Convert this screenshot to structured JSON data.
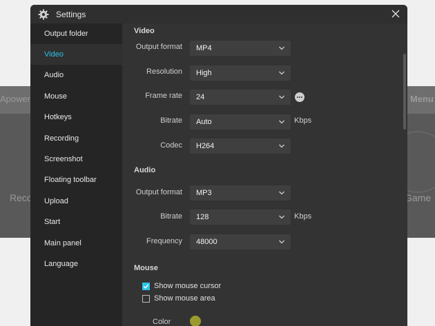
{
  "background": {
    "left_text": "ApowerR",
    "right_text": "Menu",
    "left_bottom": "Reco",
    "right_bottom": "Game"
  },
  "dialog": {
    "title": "Settings",
    "icons": {
      "settings": "gear-icon",
      "close": "close-icon"
    }
  },
  "sidebar": {
    "items": [
      {
        "label": "Output folder",
        "active": false
      },
      {
        "label": "Video",
        "active": true
      },
      {
        "label": "Audio",
        "active": false
      },
      {
        "label": "Mouse",
        "active": false
      },
      {
        "label": "Hotkeys",
        "active": false
      },
      {
        "label": "Recording",
        "active": false
      },
      {
        "label": "Screenshot",
        "active": false
      },
      {
        "label": "Floating toolbar",
        "active": false
      },
      {
        "label": "Upload",
        "active": false
      },
      {
        "label": "Start",
        "active": false
      },
      {
        "label": "Main panel",
        "active": false
      },
      {
        "label": "Language",
        "active": false
      }
    ]
  },
  "video": {
    "title": "Video",
    "output_format": {
      "label": "Output format",
      "value": "MP4"
    },
    "resolution": {
      "label": "Resolution",
      "value": "High"
    },
    "frame_rate": {
      "label": "Frame rate",
      "value": "24"
    },
    "bitrate": {
      "label": "Bitrate",
      "value": "Auto",
      "unit": "Kbps"
    },
    "codec": {
      "label": "Codec",
      "value": "H264"
    }
  },
  "audio": {
    "title": "Audio",
    "output_format": {
      "label": "Output format",
      "value": "MP3"
    },
    "bitrate": {
      "label": "Bitrate",
      "value": "128",
      "unit": "Kbps"
    },
    "frequency": {
      "label": "Frequency",
      "value": "48000"
    }
  },
  "mouse": {
    "title": "Mouse",
    "show_cursor": {
      "label": "Show mouse cursor",
      "checked": true
    },
    "show_area": {
      "label": "Show mouse area",
      "checked": false
    },
    "color": {
      "label": "Color",
      "value": "#9a9a2e"
    }
  },
  "colors": {
    "accent": "#2bc4e8",
    "dialog_bg": "#333333",
    "sidebar_bg": "#252525"
  }
}
